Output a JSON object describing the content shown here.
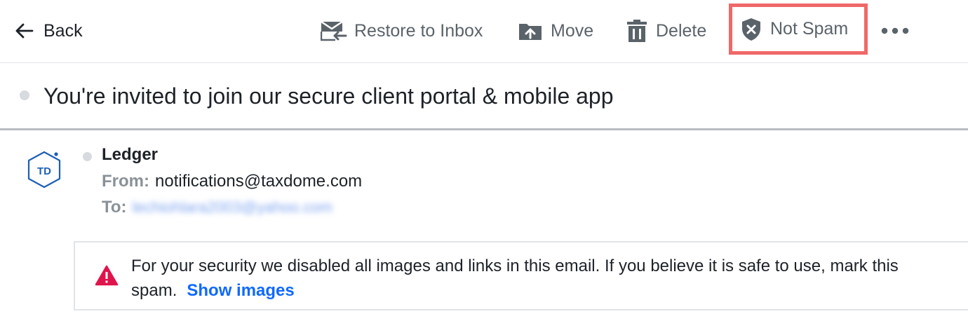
{
  "toolbar": {
    "back_label": "Back",
    "restore_label": "Restore to Inbox",
    "move_label": "Move",
    "delete_label": "Delete",
    "not_spam_label": "Not Spam",
    "more_icon": "more-horizontal-icon"
  },
  "message": {
    "subject": "You're invited to join our secure client portal & mobile app",
    "sender_name": "Ledger",
    "avatar_text": "TD",
    "from_label": "From:",
    "from_address": "notifications@taxdome.com",
    "to_label": "To:",
    "to_address": "lechiohlara2003@yahoo.com"
  },
  "notice": {
    "line1": "For your security we disabled all images and links in this email. If you believe it is safe to use, mark this",
    "line2": "spam.",
    "link": "Show images"
  },
  "colors": {
    "highlight_border": "#f06868",
    "link": "#0f69ff",
    "warning": "#e0144c",
    "avatar": "#1d5fb5"
  }
}
